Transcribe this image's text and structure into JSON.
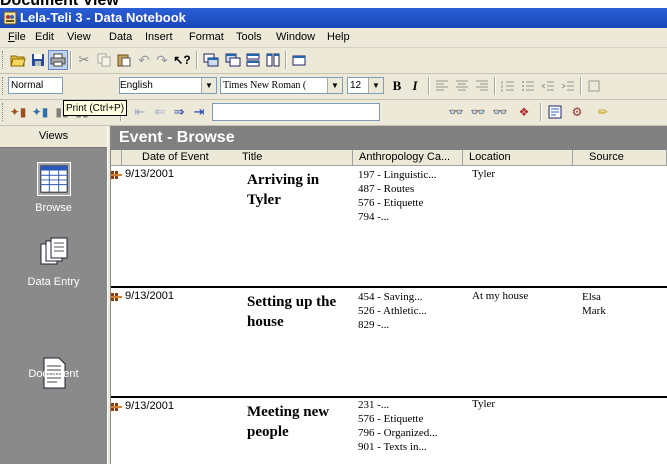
{
  "doc_heading": "Document View",
  "window": {
    "title": "Lela-Teli 3 - Data Notebook"
  },
  "menu": [
    "File",
    "Edit",
    "View",
    "Data",
    "Insert",
    "Format",
    "Tools",
    "Window",
    "Help"
  ],
  "menu_access": [
    "F",
    "E",
    "V",
    "D",
    "I",
    "o",
    "T",
    "W",
    "H"
  ],
  "format_bar": {
    "style_value": "Normal",
    "language_value": "English",
    "font_value": "Times New Roman (",
    "size_value": "12",
    "bold_label": "B",
    "italic_label": "I"
  },
  "tooltip": "Print (Ctrl+P)",
  "sidebar": {
    "header": "Views",
    "items": [
      {
        "label": "Browse",
        "icon": "browse-grid-icon",
        "selected": true
      },
      {
        "label": "Data Entry",
        "icon": "data-entry-cards-icon",
        "selected": false
      },
      {
        "label": "Document",
        "icon": "document-page-icon",
        "selected": false
      }
    ]
  },
  "browse": {
    "header": "Event - Browse",
    "columns": [
      "Date of Event",
      "Title",
      "Anthropology Ca...",
      "Location",
      "Source"
    ],
    "rows": [
      {
        "date": "9/13/2001",
        "title": "Arriving in Tyler",
        "cats": [
          "197 - Linguistic...",
          "487 - Routes",
          "576 - Etiquette",
          "794 -..."
        ],
        "location": "Tyler",
        "source": ""
      },
      {
        "date": "9/13/2001",
        "title": "Setting up the house",
        "cats": [
          "454 - Saving...",
          "526 - Athletic...",
          "829 -..."
        ],
        "location": "At my house",
        "source": "Elsa\nMark"
      },
      {
        "date": "9/13/2001",
        "title": "Meeting new people",
        "cats": [
          "231 -...",
          "576 - Etiquette",
          "796 - Organized...",
          "901 - Texts in..."
        ],
        "location": "Tyler",
        "source": ""
      }
    ]
  },
  "colors": {
    "titlebar": "#1f4fc4",
    "sidebar": "#8a8a8a",
    "browse_header": "#808080",
    "toolbar": "#ece9d8"
  }
}
